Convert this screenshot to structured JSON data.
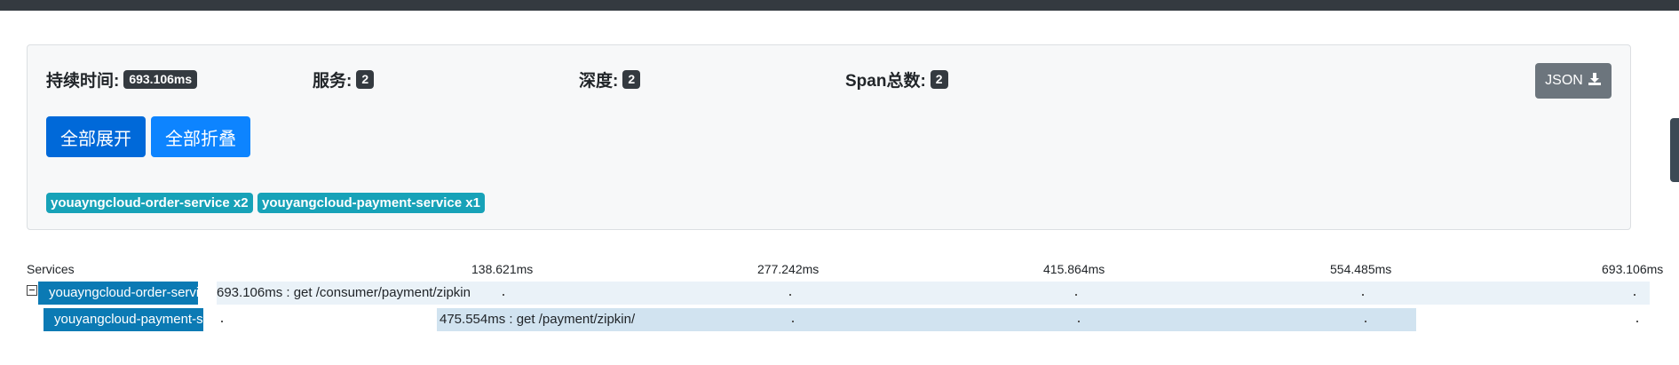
{
  "summary": {
    "duration_label": "持续时间:",
    "duration_value": "693.106ms",
    "services_label": "服务:",
    "services_value": "2",
    "depth_label": "深度:",
    "depth_value": "2",
    "spans_label": "Span总数:",
    "spans_value": "2",
    "json_button_label": "JSON",
    "expand_all_label": "全部展开",
    "collapse_all_label": "全部折叠",
    "service_badges": [
      "youayngcloud-order-service x2",
      "youyangcloud-payment-service x1"
    ]
  },
  "timeline": {
    "services_header": "Services",
    "ticks": [
      "138.621ms",
      "277.242ms",
      "415.864ms",
      "554.485ms",
      "693.106ms"
    ],
    "rows": [
      {
        "service": "youayngcloud-order-service",
        "span_label": "693.106ms : get /consumer/payment/zipkin"
      },
      {
        "service": "youyangcloud-payment-service",
        "span_label": "475.554ms : get /payment/zipkin/"
      }
    ]
  },
  "colors": {
    "topbar": "#343a40",
    "primary": "#0069d9",
    "info_badge": "#17a2b8",
    "service_label_bg": "#0b7ab4",
    "span_bar": "#d1e3f0"
  }
}
